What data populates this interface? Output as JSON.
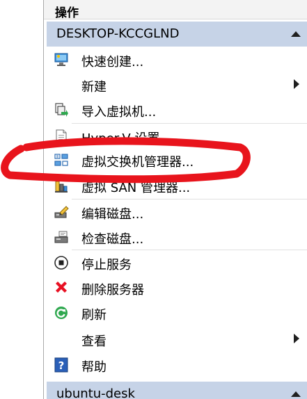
{
  "panel": {
    "title": "操作"
  },
  "sections": [
    {
      "header": "DESKTOP-KCCGLND",
      "items": [
        {
          "label": "快速创建...",
          "icon": "quick-create-icon",
          "submenu": false
        },
        {
          "label": "新建",
          "icon": "",
          "submenu": true
        },
        {
          "label": "导入虚拟机...",
          "icon": "import-vm-icon",
          "submenu": false
        },
        {
          "label": "Hyper-V 设置...",
          "icon": "settings-document-icon",
          "submenu": false
        },
        {
          "label": "虚拟交换机管理器...",
          "icon": "virtual-switch-icon",
          "submenu": false
        },
        {
          "label": "虚拟 SAN 管理器...",
          "icon": "san-manager-icon",
          "submenu": false
        },
        {
          "label": "编辑磁盘...",
          "icon": "edit-disk-icon",
          "submenu": false
        },
        {
          "label": "检查磁盘...",
          "icon": "inspect-disk-icon",
          "submenu": false
        },
        {
          "label": "停止服务",
          "icon": "stop-service-icon",
          "submenu": false
        },
        {
          "label": "删除服务器",
          "icon": "remove-server-icon",
          "submenu": false
        },
        {
          "label": "刷新",
          "icon": "refresh-icon",
          "submenu": false
        },
        {
          "label": "查看",
          "icon": "",
          "submenu": true
        },
        {
          "label": "帮助",
          "icon": "help-icon",
          "submenu": false
        }
      ]
    },
    {
      "header": "ubuntu-desk",
      "items": []
    }
  ],
  "colors": {
    "section_header_bg": "#c6d3e7",
    "annotation_red": "#e8141c"
  }
}
